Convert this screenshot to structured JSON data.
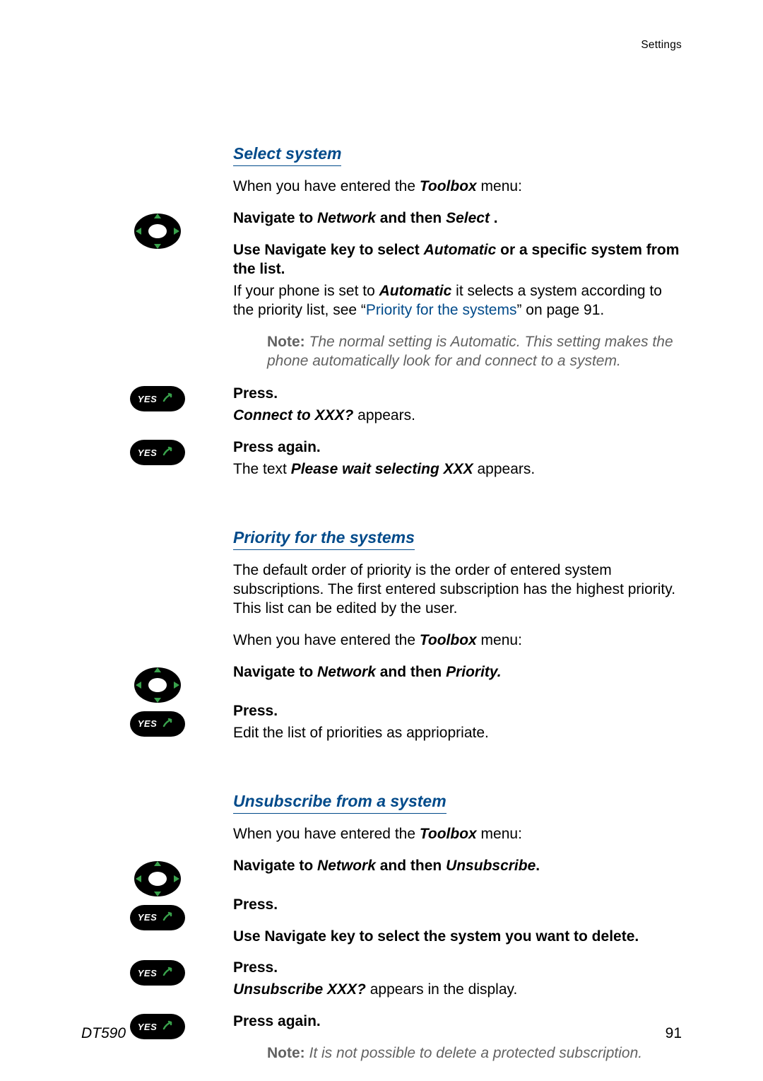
{
  "header": "Settings",
  "sel": {
    "heading": "Select system",
    "intro_pre": "When you have entered the ",
    "intro_bi": "Toolbox",
    "intro_post": " menu:",
    "nav_pre": "Navigate to ",
    "nav_bi1": "Network",
    "nav_mid": " and then ",
    "nav_bi2": "Select ",
    "nav_post": ".",
    "usekey_pre": "Use Navigate key to select ",
    "usekey_bi": "Automatic",
    "usekey_post": " or a specific system from the list.",
    "ifauto_pre": "If your phone is set to ",
    "ifauto_bi": "Automatic",
    "ifauto_mid": " it selects a system according to the priority list, see “",
    "ifauto_link": "Priority for the systems",
    "ifauto_post": "” on page 91.",
    "note_label": "Note:",
    "note_text": "The normal setting is Automatic. This setting makes the phone automatically look for and connect to a system.",
    "press": "Press.",
    "connect_i": "Connect to XXX?",
    "connect_post": " appears.",
    "press_again": "Press again.",
    "pw_pre": "The text ",
    "pw_bi": "Please wait selecting XXX",
    "pw_post": " appears."
  },
  "prio": {
    "heading": "Priority for the systems",
    "body": "The default order of priority is the order of entered system subscriptions. The first entered subscription has the highest priority. This list can be edited by the user.",
    "intro_pre": "When you have entered the ",
    "intro_bi": "Toolbox",
    "intro_post": " menu:",
    "nav_pre": "Navigate to ",
    "nav_bi1": "Network",
    "nav_mid": " and then ",
    "nav_bi2": "Priority.",
    "press": "Press.",
    "edit": "Edit the list of priorities as appriopriate."
  },
  "unsub": {
    "heading": "Unsubscribe from a system",
    "intro_pre": "When you have entered the ",
    "intro_bi": "Toolbox",
    "intro_post": " menu:",
    "nav_pre": "Navigate to ",
    "nav_bi1": "Network",
    "nav_mid": " and then ",
    "nav_bi2": "Unsubscribe",
    "nav_post": ".",
    "press": "Press.",
    "usekey": "Use Navigate key to select the system you want to delete.",
    "press2": "Press.",
    "unsub_i": "Unsubscribe XXX?",
    "unsub_post": " appears in the display.",
    "press_again": "Press again.",
    "note_label": "Note:",
    "note_text": "It is not possible to delete a protected subscription."
  },
  "footer": {
    "model": "DT590",
    "page": "91"
  },
  "icons": {
    "yes_label": "YES"
  }
}
